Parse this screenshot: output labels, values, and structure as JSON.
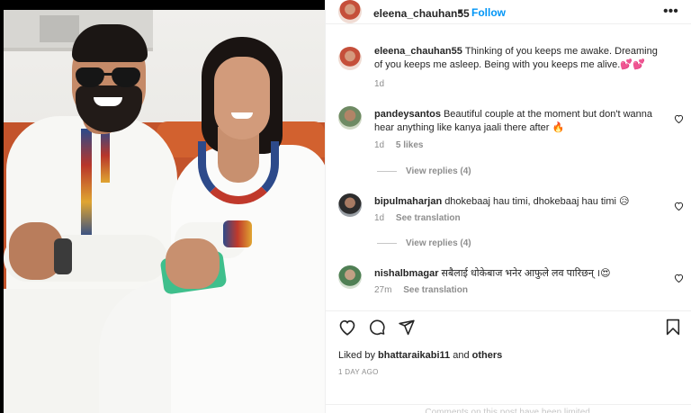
{
  "post": {
    "username": "eleena_chauhan55",
    "follow_label": "Follow",
    "more_label": "•••"
  },
  "caption": {
    "username": "eleena_chauhan55",
    "text": "Thinking of you keeps me awake. Dreaming of you keeps me asleep. Being with you keeps me alive.💕💕",
    "time": "1d"
  },
  "comments": [
    {
      "username": "pandeysantos",
      "text": "Beautiful couple at the moment but don't wanna hear anything like kanya jaali there after 🔥",
      "time": "1d",
      "likes": "5 likes",
      "replies": "View replies (4)"
    },
    {
      "username": "bipulmaharjan",
      "text": "dhokebaaj hau timi, dhokebaaj hau timi 😥",
      "time": "1d",
      "translate": "See translation",
      "replies": "View replies (4)"
    },
    {
      "username": "nishalbmagar",
      "text": "सबैलाई धोकेबाज भनेर आफुले लव पारिछन् ।😍",
      "time": "27m",
      "translate": "See translation"
    }
  ],
  "footer": {
    "liked_prefix": "Liked by",
    "liked_user": "bhattaraikabi11",
    "liked_and": "and",
    "liked_others": "others",
    "time_ago": "1 DAY AGO",
    "limited": "Comments on this post have been limited."
  },
  "icons": {
    "like": "heart-icon",
    "comment": "comment-icon",
    "share": "share-icon",
    "save": "bookmark-icon",
    "more": "more-icon",
    "comment_like": "heart-icon"
  },
  "colors": {
    "accent": "#0095f6",
    "text": "#262626",
    "muted": "#8e8e8e",
    "border": "#efefef"
  }
}
